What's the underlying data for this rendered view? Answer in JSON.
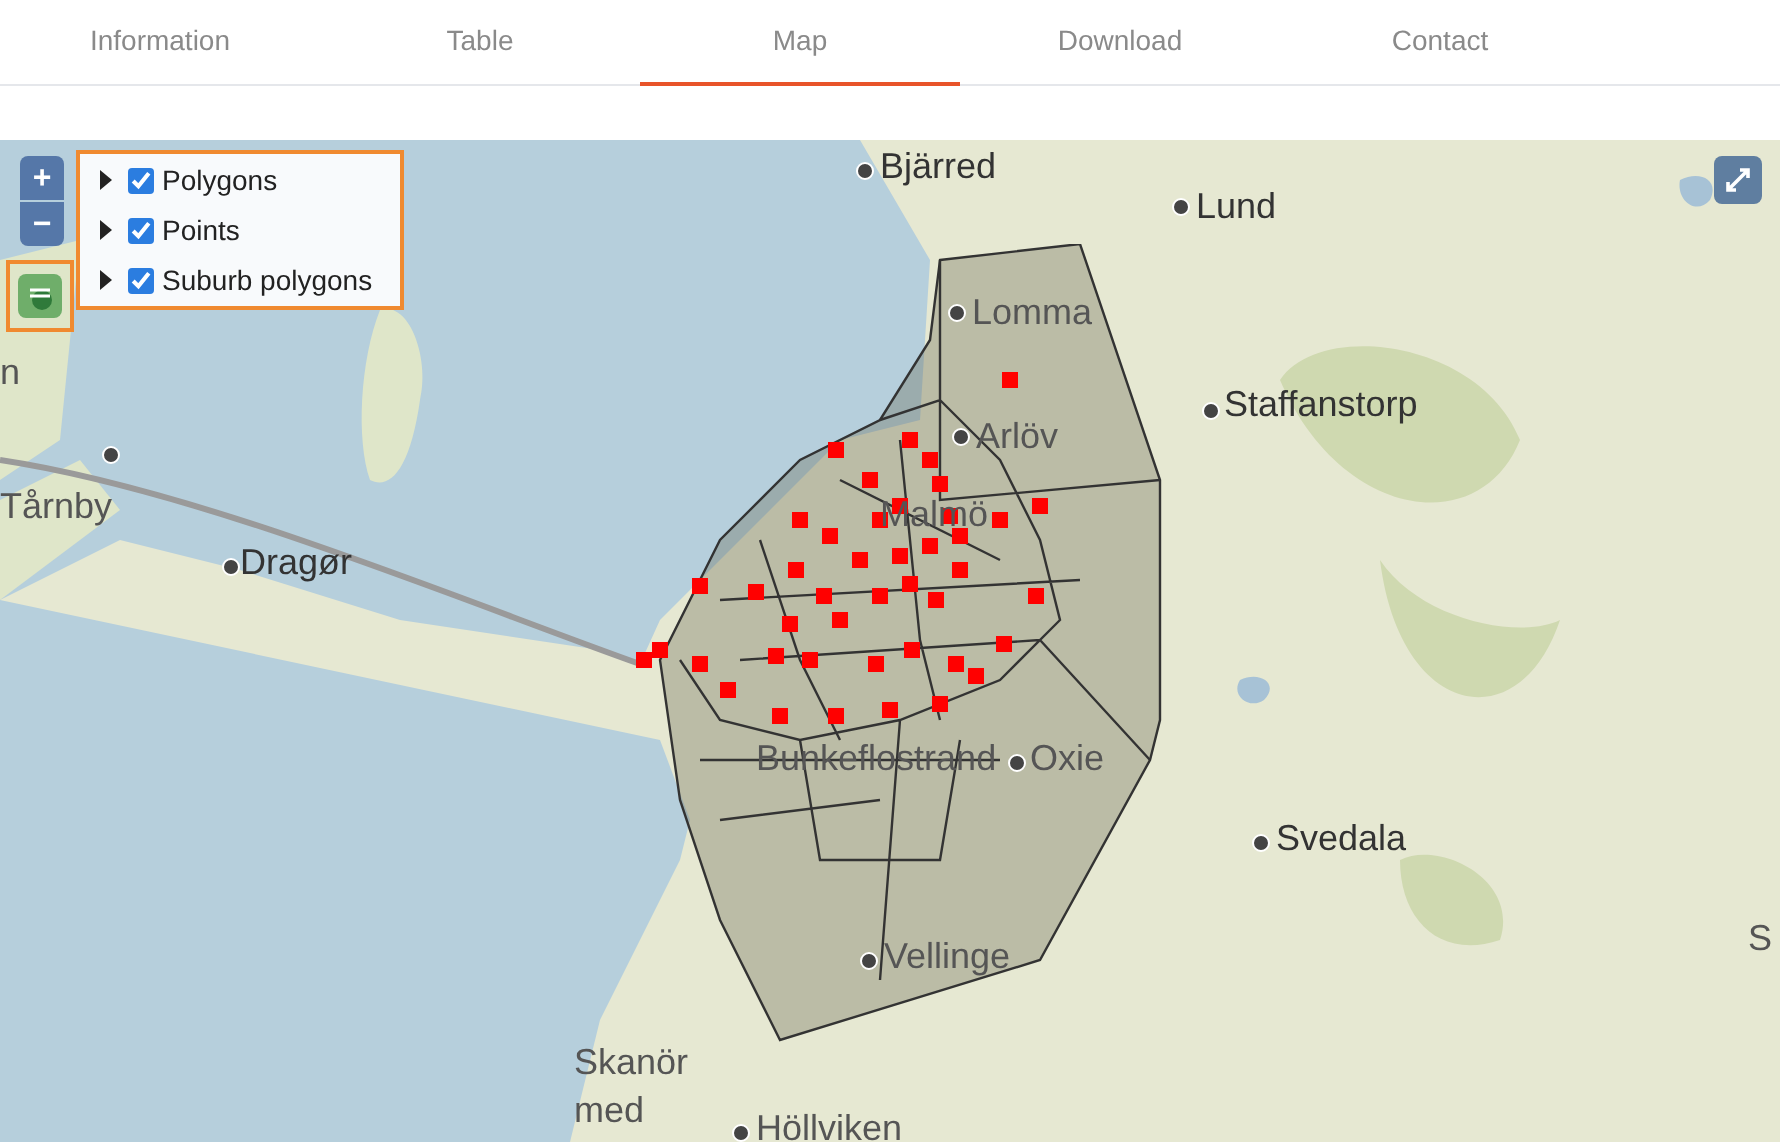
{
  "tabs": [
    {
      "label": "Information",
      "selected": false
    },
    {
      "label": "Table",
      "selected": false
    },
    {
      "label": "Map",
      "selected": true
    },
    {
      "label": "Download",
      "selected": false
    },
    {
      "label": "Contact",
      "selected": false
    }
  ],
  "map": {
    "zoom_in": "+",
    "zoom_out": "−",
    "layers": [
      {
        "label": "Polygons",
        "checked": true
      },
      {
        "label": "Points",
        "checked": true
      },
      {
        "label": "Suburb polygons",
        "checked": true
      }
    ],
    "places": [
      "Bjärred",
      "Lund",
      "Lomma",
      "n",
      "Staffanstorp",
      "Arlöv",
      "Tårnby",
      "Malmö",
      "Dragør",
      "Bunkeflostrand",
      "Oxie",
      "Svedala",
      "Vellinge",
      "S",
      "Skanör",
      "med",
      "Höllviken"
    ]
  }
}
